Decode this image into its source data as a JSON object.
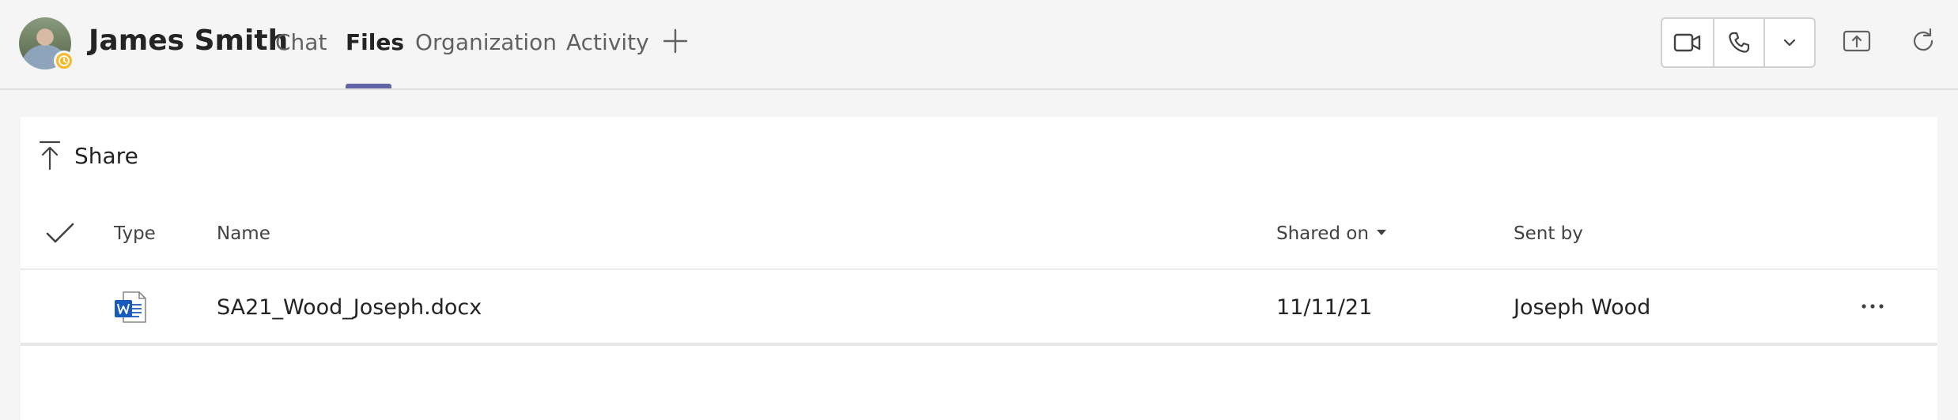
{
  "header": {
    "contact_name": "James Smith",
    "presence": "away",
    "tabs": [
      {
        "label": "Chat",
        "active": false
      },
      {
        "label": "Files",
        "active": true
      },
      {
        "label": "Organization",
        "active": false
      },
      {
        "label": "Activity",
        "active": false
      }
    ],
    "add_tab_icon": "plus-icon",
    "actions": [
      "video-call-icon",
      "audio-call-icon",
      "chevron-down-icon",
      "share-screen-icon",
      "refresh-icon"
    ]
  },
  "toolbar": {
    "share_label": "Share"
  },
  "table": {
    "columns": {
      "type": "Type",
      "name": "Name",
      "shared_on": "Shared on",
      "sent_by": "Sent by"
    },
    "sort_column": "shared_on",
    "rows": [
      {
        "type_icon": "word-document-icon",
        "name": "SA21_Wood_Joseph.docx",
        "shared_on": "11/11/21",
        "sent_by": "Joseph Wood"
      }
    ]
  },
  "colors": {
    "accent": "#6264a7",
    "presence_away": "#f8b82c",
    "word_blue": "#185abd"
  }
}
